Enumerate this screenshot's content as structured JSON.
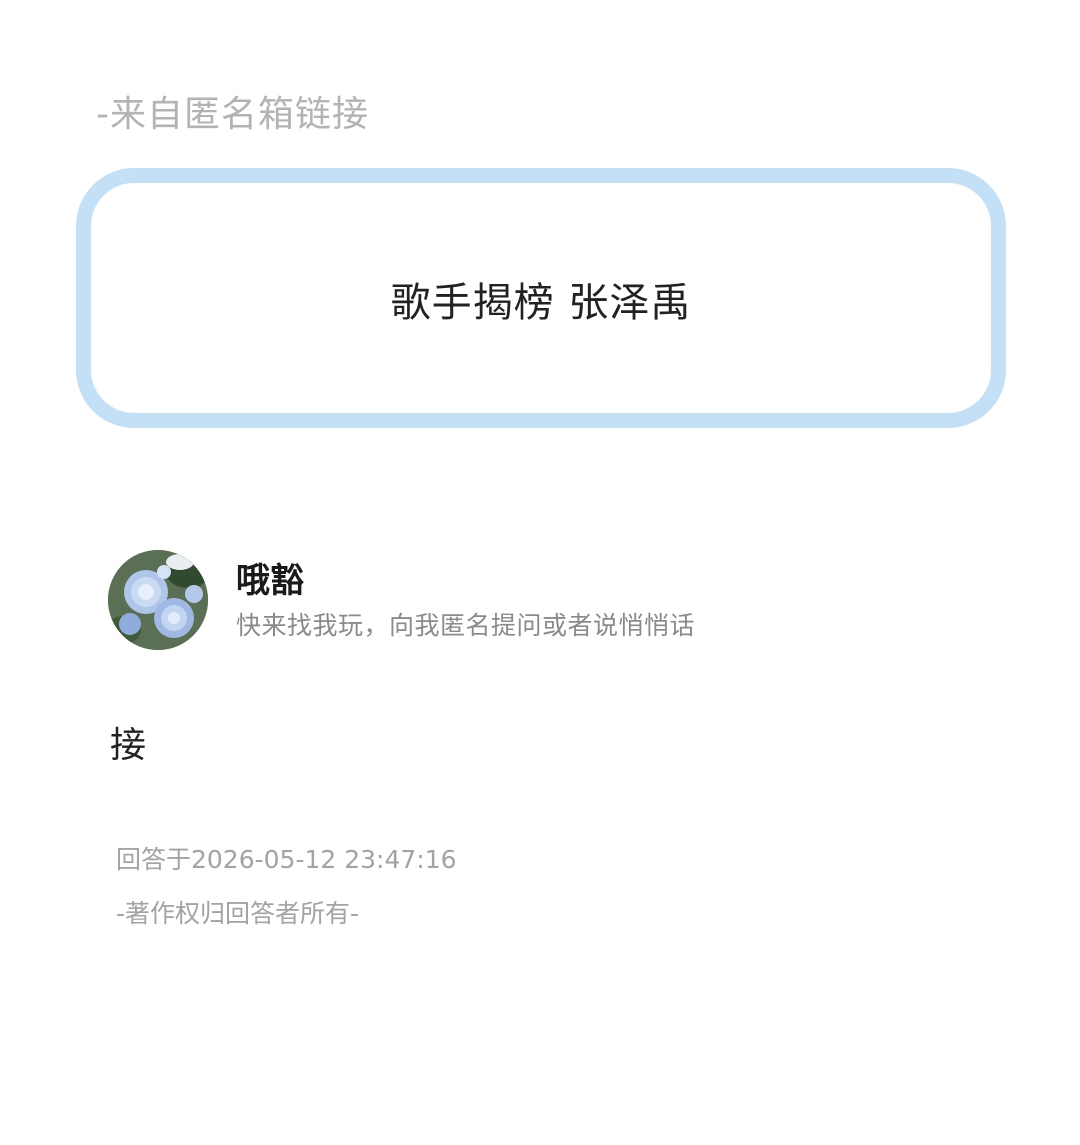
{
  "source_label": "-来自匿名箱链接",
  "question": {
    "text": "歌手揭榜 张泽禹"
  },
  "responder": {
    "name": "哦豁",
    "bio": "快来找我玩，向我匿名提问或者说悄悄话",
    "avatar_icon": "blue-rose-avatar"
  },
  "answer": {
    "text": "接",
    "timestamp": "回答于2026-05-12 23:47:16",
    "copyright": "-著作权归回答者所有-"
  },
  "colors": {
    "card_border": "#c3e0f7",
    "muted_text": "#a3a3a3",
    "primary_text": "#222222"
  }
}
